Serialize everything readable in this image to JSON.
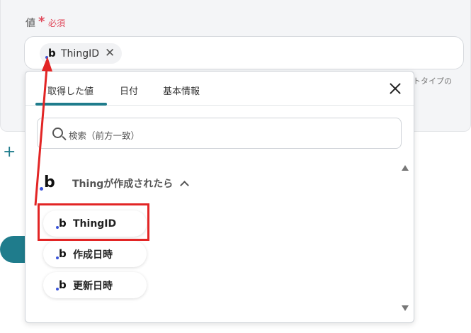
{
  "field": {
    "label": "値",
    "required_star": "*",
    "required_text": "必須",
    "chip_label": "ThingID",
    "hint_text": "トタイプの"
  },
  "popup": {
    "tabs": [
      {
        "label": "取得した値",
        "active": true
      },
      {
        "label": "日付",
        "active": false
      },
      {
        "label": "基本情報",
        "active": false
      }
    ],
    "search_placeholder": "検索（前方一致）",
    "group_title": "Thingが作成されたら",
    "items": [
      {
        "label": "ThingID",
        "highlighted": true
      },
      {
        "label": "作成日時",
        "highlighted": false
      },
      {
        "label": "更新日時",
        "highlighted": false
      }
    ]
  },
  "logo_letter": "b",
  "colors": {
    "accent": "#1f7c8c",
    "required": "#e0485a",
    "annotation": "#e22525",
    "logo_dot": "#3a54d9"
  },
  "icons": [
    "close-icon",
    "search-icon",
    "chevron-up-icon",
    "plus-icon",
    "scroll-up-icon",
    "scroll-down-icon",
    "brand-logo-icon"
  ]
}
